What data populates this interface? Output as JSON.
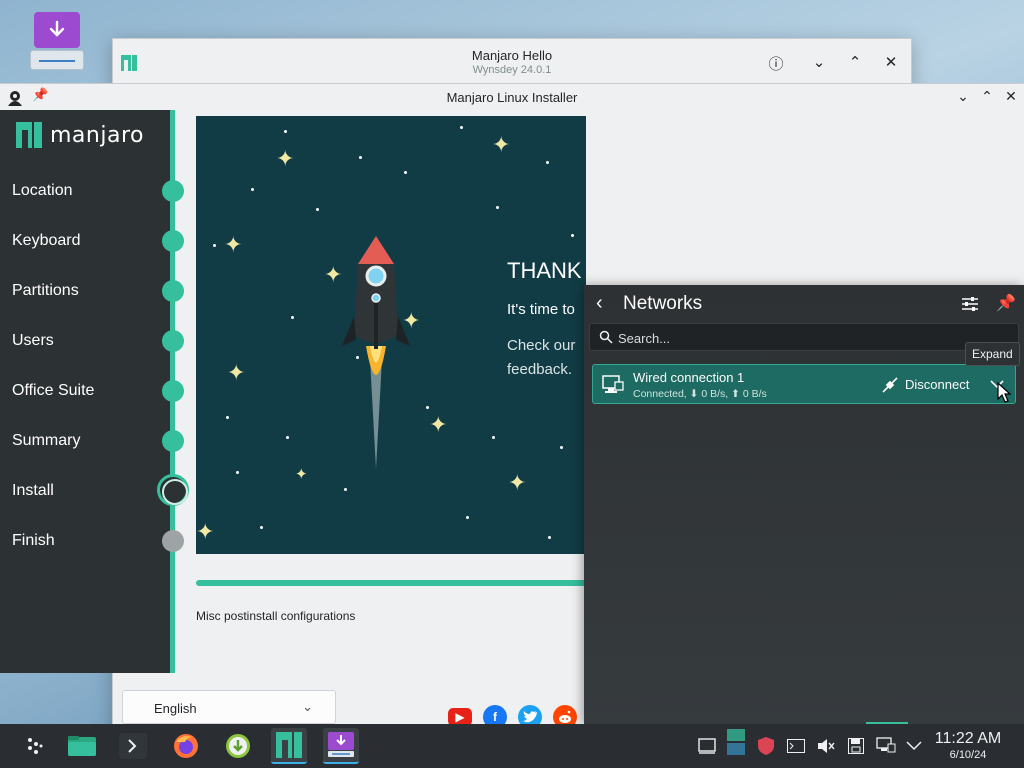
{
  "hello_window": {
    "title": "Manjaro Hello",
    "subtitle": "Wynsdey 24.0.1",
    "language": "English"
  },
  "installer": {
    "title": "Manjaro Linux Installer",
    "brand": "manjaro",
    "steps": [
      {
        "label": "Location",
        "state": "done"
      },
      {
        "label": "Keyboard",
        "state": "done"
      },
      {
        "label": "Partitions",
        "state": "done"
      },
      {
        "label": "Users",
        "state": "done"
      },
      {
        "label": "Office Suite",
        "state": "done"
      },
      {
        "label": "Summary",
        "state": "done"
      },
      {
        "label": "Install",
        "state": "current"
      },
      {
        "label": "Finish",
        "state": "todo"
      }
    ],
    "slide": {
      "heading": "THANK YOU",
      "tagline": "It's time to",
      "check_line1": "Check our",
      "check_line2": "feedback."
    },
    "status": "Misc postinstall configurations",
    "accent_color": "#35bf9c"
  },
  "networks": {
    "title": "Networks",
    "search_placeholder": "Search...",
    "tooltip": "Expand",
    "connection": {
      "name": "Wired connection 1",
      "details": "Connected, ⬇ 0 B/s, ⬆ 0 B/s",
      "action": "Disconnect"
    }
  },
  "taskbar": {
    "time": "11:22 AM",
    "date": "6/10/24"
  }
}
